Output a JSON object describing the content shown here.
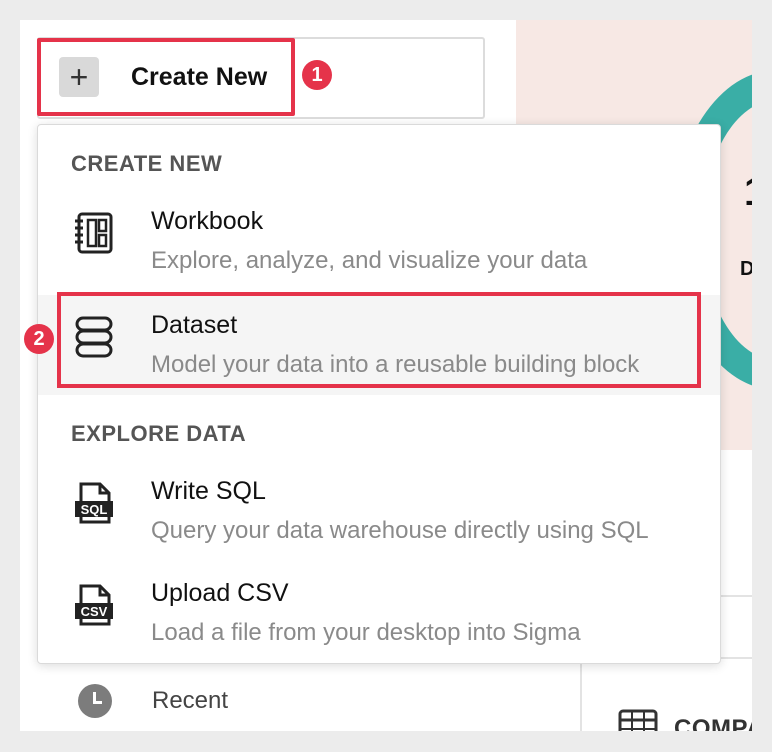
{
  "create_button": {
    "label": "Create New"
  },
  "badges": {
    "step1": "1",
    "step2": "2"
  },
  "menu": {
    "sections": [
      {
        "header": "CREATE NEW",
        "items": [
          {
            "icon": "workbook-icon",
            "title": "Workbook",
            "description": "Explore, analyze, and visualize your data"
          },
          {
            "icon": "dataset-icon",
            "title": "Dataset",
            "description": "Model your data into a reusable building block"
          }
        ]
      },
      {
        "header": "EXPLORE DATA",
        "items": [
          {
            "icon": "sql-file-icon",
            "title": "Write SQL",
            "description": "Query your data warehouse directly using SQL",
            "icon_text": "SQL"
          },
          {
            "icon": "csv-file-icon",
            "title": "Upload CSV",
            "description": "Load a file from your desktop into Sigma",
            "icon_text": "CSV"
          }
        ]
      }
    ]
  },
  "sidebar": {
    "recent_label": "Recent"
  },
  "background": {
    "comp_label": "COMPA",
    "glimpse_number": "1",
    "glimpse_letter": "D"
  },
  "colors": {
    "annotation": "#e5334a",
    "accent_teal": "#3aaea6",
    "panel_pink": "#f7e8e4"
  }
}
